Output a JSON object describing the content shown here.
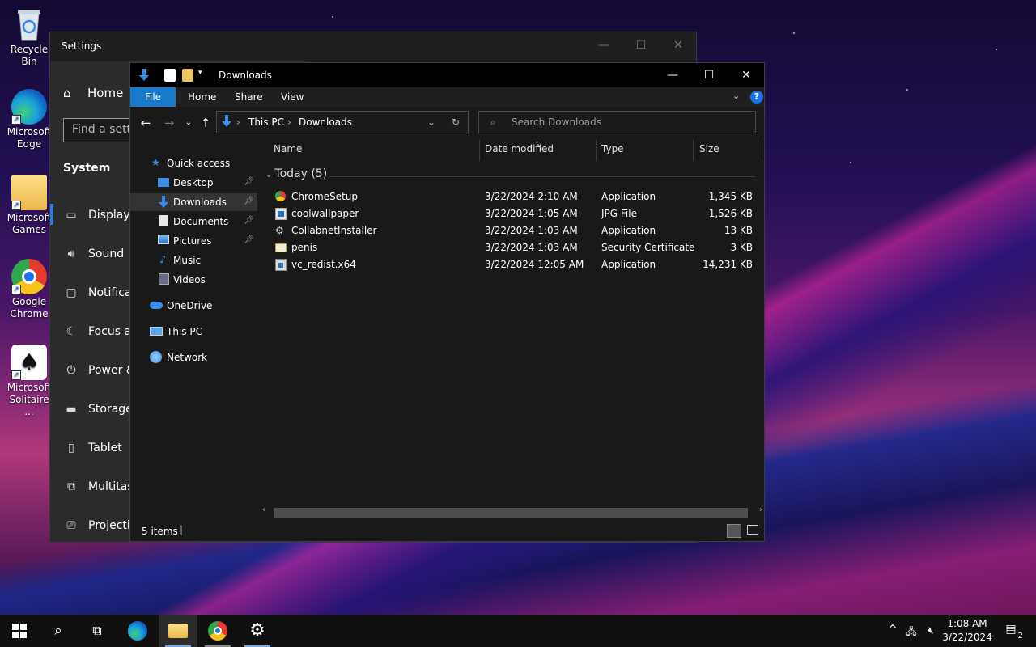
{
  "desktop": {
    "icons": [
      {
        "label": "Recycle Bin",
        "name": "recycle-bin-icon"
      },
      {
        "label": "Microsoft Edge",
        "name": "edge-icon"
      },
      {
        "label": "Microsoft Games",
        "name": "folder-icon"
      },
      {
        "label": "Google Chrome",
        "name": "chrome-icon"
      },
      {
        "label": "Microsoft Solitaire ...",
        "name": "solitaire-icon"
      }
    ]
  },
  "settings": {
    "title": "Settings",
    "home": "Home",
    "search_placeholder": "Find a setting",
    "category": "System",
    "nav": [
      "Display",
      "Sound",
      "Notifications & actions",
      "Focus assist",
      "Power & sleep",
      "Storage",
      "Tablet",
      "Multitasking",
      "Projecting to this PC"
    ]
  },
  "explorer": {
    "title": "Downloads",
    "ribbon_tabs": [
      "File",
      "Home",
      "Share",
      "View"
    ],
    "address": {
      "root": "This PC",
      "current": "Downloads"
    },
    "search_placeholder": "Search Downloads",
    "nav_pane": {
      "quick_access": "Quick access",
      "items": [
        "Desktop",
        "Downloads",
        "Documents",
        "Pictures",
        "Music",
        "Videos"
      ],
      "onedrive": "OneDrive",
      "this_pc": "This PC",
      "network": "Network"
    },
    "columns": {
      "name": "Name",
      "date": "Date modified",
      "type": "Type",
      "size": "Size"
    },
    "group_label": "Today (5)",
    "files": [
      {
        "name": "ChromeSetup",
        "date": "3/22/2024 2:10 AM",
        "type": "Application",
        "size": "1,345 KB",
        "icon": "chrome-setup-icon"
      },
      {
        "name": "coolwallpaper",
        "date": "3/22/2024 1:05 AM",
        "type": "JPG File",
        "size": "1,526 KB",
        "icon": "image-file-icon"
      },
      {
        "name": "CollabnetInstaller",
        "date": "3/22/2024 1:03 AM",
        "type": "Application",
        "size": "13 KB",
        "icon": "installer-icon"
      },
      {
        "name": "penis",
        "date": "3/22/2024 1:03 AM",
        "type": "Security Certificate",
        "size": "3 KB",
        "icon": "certificate-icon"
      },
      {
        "name": "vc_redist.x64",
        "date": "3/22/2024 12:05 AM",
        "type": "Application",
        "size": "14,231 KB",
        "icon": "setup-exe-icon"
      }
    ],
    "status": "5 items"
  },
  "taskbar": {
    "time": "1:08 AM",
    "date": "3/22/2024",
    "notification_count": "2"
  }
}
